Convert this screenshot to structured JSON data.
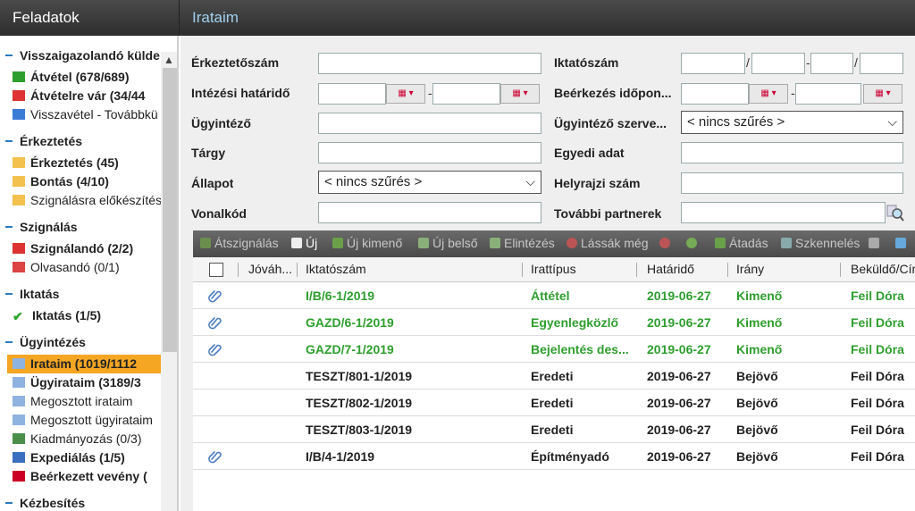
{
  "header": {
    "left_title": "Feladatok",
    "right_title": "Irataim"
  },
  "sidebar": {
    "sections": [
      {
        "label": "Visszaigazolandó külde",
        "items": [
          {
            "label": "Átvétel (678/689)",
            "bold": true,
            "icon": "arrow-green-icon"
          },
          {
            "label": "Átvételre vár (34/44",
            "bold": true,
            "icon": "arrow-red-icon"
          },
          {
            "label": "Visszavétel - Továbbkü",
            "bold": false,
            "icon": "arrow-blue-icon"
          }
        ]
      },
      {
        "label": "Érkeztetés",
        "items": [
          {
            "label": "Érkeztetés (45)",
            "bold": true,
            "icon": "envelope-icon"
          },
          {
            "label": "Bontás (4/10)",
            "bold": true,
            "icon": "envelope-icon"
          },
          {
            "label": "Szignálásra előkészítés",
            "bold": false,
            "icon": "envelope-icon"
          }
        ]
      },
      {
        "label": "Szignálás",
        "items": [
          {
            "label": "Szignálandó (2/2)",
            "bold": true,
            "icon": "check-red-icon"
          },
          {
            "label": "Olvasandó (0/1)",
            "bold": false,
            "icon": "clock-icon"
          }
        ]
      },
      {
        "label": "Iktatás",
        "items": [
          {
            "label": "Iktatás (1/5)",
            "bold": true,
            "icon": "checkmark-icon"
          }
        ]
      },
      {
        "label": "Ügyintézés",
        "items": [
          {
            "label": "Irataim (1019/1112",
            "bold": true,
            "icon": "document-icon",
            "selected": true
          },
          {
            "label": "Ügyirataim (3189/3",
            "bold": true,
            "icon": "document-icon"
          },
          {
            "label": "Megosztott irataim",
            "bold": false,
            "icon": "document-icon"
          },
          {
            "label": "Megosztott ügyirataim",
            "bold": false,
            "icon": "document-icon"
          },
          {
            "label": "Kiadmányozás (0/3)",
            "bold": false,
            "icon": "sign-icon"
          },
          {
            "label": "Expediálás (1/5)",
            "bold": true,
            "icon": "send-icon"
          },
          {
            "label": "Beérkezett vevény (",
            "bold": true,
            "icon": "receipt-icon"
          }
        ]
      },
      {
        "label": "Kézbesítés",
        "items": []
      }
    ]
  },
  "filters": {
    "erkeztetoszam": {
      "label": "Érkeztetőszám",
      "value": ""
    },
    "iktatoszam": {
      "label": "Iktatószám",
      "sep1": "/",
      "sep2": "-",
      "sep3": "/"
    },
    "intezesi_hatarido": {
      "label": "Intézési határidő",
      "sep": "-"
    },
    "beerkezes": {
      "label": "Beérkezés időpon...",
      "sep": "-"
    },
    "ugyintezo": {
      "label": "Ügyintéző",
      "value": ""
    },
    "ugyintezo_szerv": {
      "label": "Ügyintéző szerve...",
      "value": "< nincs szűrés >"
    },
    "targy": {
      "label": "Tárgy",
      "value": ""
    },
    "egyedi_adat": {
      "label": "Egyedi adat",
      "value": ""
    },
    "allapot": {
      "label": "Állapot",
      "value": "< nincs szűrés >"
    },
    "helyrajzi": {
      "label": "Helyrajzi szám",
      "value": ""
    },
    "vonalkod": {
      "label": "Vonalkód",
      "value": ""
    },
    "tovabbi_partnerek": {
      "label": "További partnerek",
      "value": ""
    }
  },
  "toolbar": {
    "atszignalas": "Átszignálás",
    "uj": "Új",
    "uj_kimeno": "Új kimenő",
    "uj_belso": "Új belső",
    "elintezes": "Elintézés",
    "lassak_meg": "Lássák még",
    "atadas": "Átadás",
    "szkenneles": "Szkennelés"
  },
  "table": {
    "columns": [
      "Jóváh...",
      "Iktatószám",
      "Irattípus",
      "Határidő",
      "Irány",
      "Beküldő/Cím"
    ],
    "rows": [
      {
        "attach": true,
        "iktatoszam": "I/B/6-1/2019",
        "irattipus": "Áttétel",
        "hatarido": "2019-06-27",
        "irany": "Kimenő",
        "bekuldo": "Feil Dóra",
        "color": "g"
      },
      {
        "attach": true,
        "iktatoszam": "GAZD/6-1/2019",
        "irattipus": "Egyenlegközlő",
        "hatarido": "2019-06-27",
        "irany": "Kimenő",
        "bekuldo": "Feil Dóra",
        "color": "g"
      },
      {
        "attach": true,
        "iktatoszam": "GAZD/7-1/2019",
        "irattipus": "Bejelentés des...",
        "hatarido": "2019-06-27",
        "irany": "Kimenő",
        "bekuldo": "Feil Dóra",
        "color": "g"
      },
      {
        "attach": false,
        "iktatoszam": "TESZT/801-1/2019",
        "irattipus": "Eredeti",
        "hatarido": "2019-06-27",
        "irany": "Bejövő",
        "bekuldo": "Feil Dóra",
        "color": "k"
      },
      {
        "attach": false,
        "iktatoszam": "TESZT/802-1/2019",
        "irattipus": "Eredeti",
        "hatarido": "2019-06-27",
        "irany": "Bejövő",
        "bekuldo": "Feil Dóra",
        "color": "k"
      },
      {
        "attach": false,
        "iktatoszam": "TESZT/803-1/2019",
        "irattipus": "Eredeti",
        "hatarido": "2019-06-27",
        "irany": "Bejövő",
        "bekuldo": "Feil Dóra",
        "color": "k"
      },
      {
        "attach": true,
        "iktatoszam": "I/B/4-1/2019",
        "irattipus": "Építményadó",
        "hatarido": "2019-06-27",
        "irany": "Bejövő",
        "bekuldo": "Feil Dóra",
        "color": "k"
      }
    ]
  },
  "colors": {
    "selected": "#f5a623",
    "green_text": "#2e9e2e",
    "header_accent": "#9fd0f0"
  }
}
